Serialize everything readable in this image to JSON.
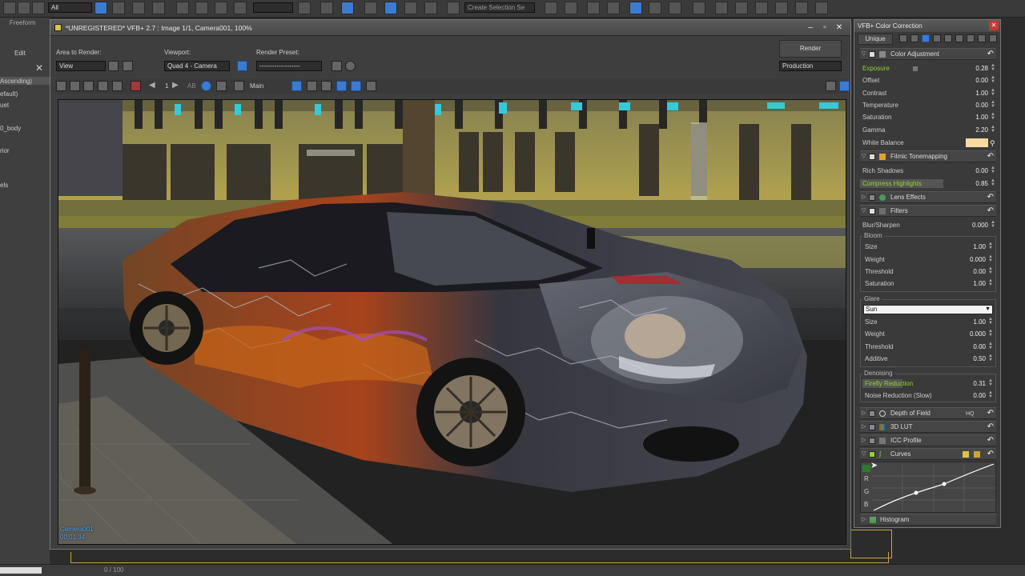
{
  "max": {
    "top_dropdown": "All",
    "selection_set_placeholder": "Create Selection Se",
    "freeform_label": "Freeform",
    "edit_label": "Edit",
    "left_items": [
      "Ascending)",
      "efault)",
      "uet",
      "0_body",
      "rior",
      "els"
    ],
    "time_display": "0 / 100"
  },
  "vfb": {
    "title": "*UNREGISTERED* VFB+ 2.7 : Image 1/1, Camera001, 100%",
    "area_label": "Area to Render:",
    "area_value": "View",
    "viewport_label": "Viewport:",
    "viewport_value": "Quad 4 - Camera",
    "preset_label": "Render Preset:",
    "preset_value": "-------------------",
    "render_label": "Render",
    "render_value": "Production",
    "page_number": "1",
    "ab_label": "AB",
    "main_label": "Main",
    "camera_name": "Camera001",
    "timecode": "00:01:34"
  },
  "cc": {
    "title": "VFB+ Color Correction",
    "unique_label": "Unique",
    "color_adjustment": {
      "title": "Color Adjustment",
      "rows": [
        {
          "name": "Exposure",
          "value": "0.28"
        },
        {
          "name": "Offset",
          "value": "0.00"
        },
        {
          "name": "Contrast",
          "value": "1.00"
        },
        {
          "name": "Temperature",
          "value": "0.00"
        },
        {
          "name": "Saturation",
          "value": "1.00"
        },
        {
          "name": "Gamma",
          "value": "2.20"
        },
        {
          "name": "White Balance",
          "value": ""
        }
      ]
    },
    "filmic": {
      "title": "Filmic Tonemapping",
      "rows": [
        {
          "name": "Rich Shadows",
          "value": "0.00"
        },
        {
          "name": "Compress Highlights",
          "value": "0.85"
        }
      ]
    },
    "lens_effects": "Lens Effects",
    "filters": {
      "title": "Filters",
      "blur_name": "Blur/Sharpen",
      "blur_value": "0.000",
      "bloom": {
        "title": "Bloom",
        "rows": [
          {
            "name": "Size",
            "value": "1.00"
          },
          {
            "name": "Weight",
            "value": "0.000"
          },
          {
            "name": "Threshold",
            "value": "0.00"
          },
          {
            "name": "Saturation",
            "value": "1.00"
          }
        ]
      },
      "glare": {
        "title": "Glare",
        "type": "Sun",
        "rows": [
          {
            "name": "Size",
            "value": "1.00"
          },
          {
            "name": "Weight",
            "value": "0.000"
          },
          {
            "name": "Threshold",
            "value": "0.00"
          },
          {
            "name": "Additive",
            "value": "0.50"
          }
        ]
      },
      "denoising": {
        "title": "Denoising",
        "rows": [
          {
            "name": "Firefly Reduction",
            "value": "0.31"
          },
          {
            "name": "Noise Reduction (Slow)",
            "value": "0.00"
          }
        ]
      }
    },
    "depth_of_field": "Depth of Field",
    "hq_label": "HQ",
    "lut": "3D LUT",
    "icc": "ICC Profile",
    "curves": "Curves",
    "curve_channels": [
      "R",
      "G",
      "B"
    ],
    "histogram": "Histogram"
  },
  "colors": {
    "accent_green": "#8fd62a",
    "blue_button": "#3b7bd0",
    "white_balance_swatch": "#f7dba0"
  }
}
